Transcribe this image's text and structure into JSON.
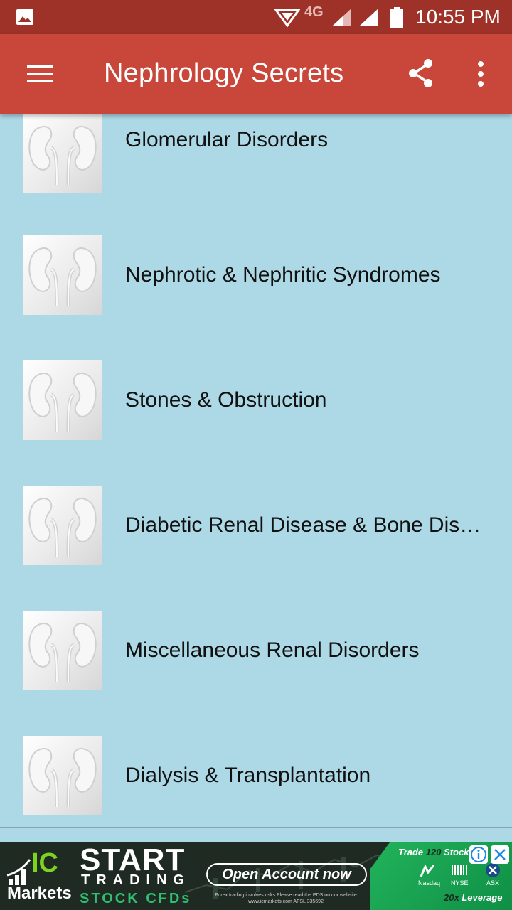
{
  "status_bar": {
    "network": "4G",
    "time": "10:55 PM",
    "icons": [
      "gallery-icon",
      "network-icon",
      "signal-icon",
      "signal-icon",
      "battery-icon"
    ]
  },
  "app_bar": {
    "title": "Nephrology Secrets",
    "icons": [
      "menu-icon",
      "share-icon",
      "more-vert-icon"
    ]
  },
  "chapters": [
    {
      "label": "Glomerular Disorders",
      "icon": "kidney-icon"
    },
    {
      "label": "Nephrotic & Nephritic Syndromes",
      "icon": "kidney-icon"
    },
    {
      "label": "Stones & Obstruction",
      "icon": "kidney-icon"
    },
    {
      "label": "Diabetic Renal Disease & Bone Dis…",
      "icon": "kidney-icon"
    },
    {
      "label": "Miscellaneous Renal Disorders",
      "icon": "kidney-icon"
    },
    {
      "label": "Dialysis & Transplantation",
      "icon": "kidney-icon"
    }
  ],
  "ad": {
    "brand_ic": "IC",
    "brand_markets": "Markets",
    "headline": "START",
    "subheadline": "TRADING",
    "tagline": "STOCK CFDs",
    "cta": "Open Account now",
    "disclaimer": "Forex trading involves risks.Please read the PDS on our website www.icmarkets.com AFSL 335692",
    "trade_prefix": "Trade",
    "trade_number": "120",
    "trade_suffix": "Stocks",
    "exchanges": [
      "Nasdaq",
      "NYSE",
      "ASX"
    ],
    "leverage_prefix": "20x",
    "leverage_suffix": "Leverage"
  },
  "colors": {
    "status_bar": "#9e3228",
    "app_bar": "#c9473a",
    "list_background": "#add8e6",
    "ad_green": "#22b35c"
  }
}
